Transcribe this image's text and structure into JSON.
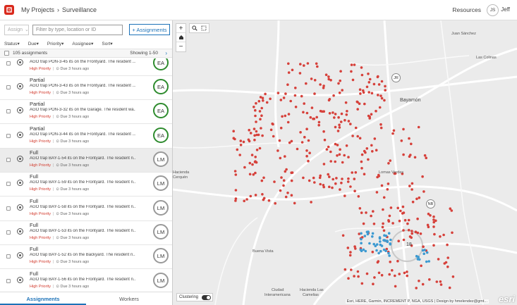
{
  "header": {
    "crumbs": [
      "My Projects",
      "›",
      "Surveillance"
    ],
    "resources": "Resources",
    "user_initials": "JS",
    "user_name": "Jeff"
  },
  "toolbar": {
    "assign_label": "Assign",
    "search_placeholder": "Filter by type, location or ID",
    "assignments_button": "+ Assignments"
  },
  "filters": [
    "Status",
    "Due",
    "Priority",
    "Assignee",
    "Sort"
  ],
  "countbar": {
    "count": "105 assignments",
    "showing": "Showing 1-50"
  },
  "assignments": [
    {
      "status": "",
      "desc": "AGO trap PON-3-45 its on the Frontyard. The resident ...",
      "priority": "High Priority",
      "due": "Due 3 hours ago",
      "badge": "EA"
    },
    {
      "status": "Partial",
      "desc": "AGO trap PON-3-43 its on the Frontyard. The resident ...",
      "priority": "High Priority",
      "due": "Due 3 hours ago",
      "badge": "EA"
    },
    {
      "status": "Partial",
      "desc": "AGO trap PON-3-32 its on the Garage. The resident wa...",
      "priority": "High Priority",
      "due": "Due 3 hours ago",
      "badge": "EA"
    },
    {
      "status": "Partial",
      "desc": "AGO trap PON-3-44 its on the Frontyard. The resident ...",
      "priority": "High Priority",
      "due": "Due 3 hours ago",
      "badge": "EA"
    },
    {
      "status": "Full",
      "desc": "AGO trap BAY-1-54 its on the Frontyard. The resident n...",
      "priority": "High Priority",
      "due": "Due 3 hours ago",
      "badge": "LM"
    },
    {
      "status": "Full",
      "desc": "AGO trap BAY-1-59 its on the Frontyard. The resident n...",
      "priority": "High Priority",
      "due": "Due 3 hours ago",
      "badge": "LM"
    },
    {
      "status": "Full",
      "desc": "AGO trap BAY-1-58 its on the Frontyard. The resident n...",
      "priority": "High Priority",
      "due": "Due 3 hours ago",
      "badge": "LM"
    },
    {
      "status": "Full",
      "desc": "AGO trap BAY-1-53 its on the Frontyard. The resident n...",
      "priority": "High Priority",
      "due": "Due 3 hours ago",
      "badge": "LM"
    },
    {
      "status": "Full",
      "desc": "AGO trap BAY-1-52 its on the Backyard. The resident n...",
      "priority": "High Priority",
      "due": "Due 3 hours ago",
      "badge": "LM"
    },
    {
      "status": "Full",
      "desc": "AGO trap BAY-1-56 its on the Frontyard. The resident n...",
      "priority": "High Priority",
      "due": "Due 3 hours ago",
      "badge": "LM"
    }
  ],
  "tabs": [
    "Assignments",
    "Workers"
  ],
  "map": {
    "places": {
      "juan_sanchez": "Juan Sánchez",
      "las_colinas": "Las Colinas",
      "bayamon": "Bayamón",
      "hacienda": "Hacienda",
      "hacienda2": "Cerquén",
      "lomas_verdes": "Lomas Verdes",
      "buena_vista": "Buena Vista",
      "ciudad": "Ciudad",
      "ciudad2": "Interamericana",
      "hacienda_las": "Hacienda Las",
      "hacienda_las2": "Camelias"
    },
    "shields": {
      "jr": "JR",
      "nb": "NB"
    },
    "cluster_count": "18",
    "clustering_label": "Clustering",
    "attribution": "Esri, HERE, Garmin, INCREMENT P, NGA, USGS | Design by hmelendez@gmt...",
    "esri_logo": "esri",
    "colors": {
      "red_points": "#d6403a",
      "blue_points": "#3d9ad1"
    }
  }
}
